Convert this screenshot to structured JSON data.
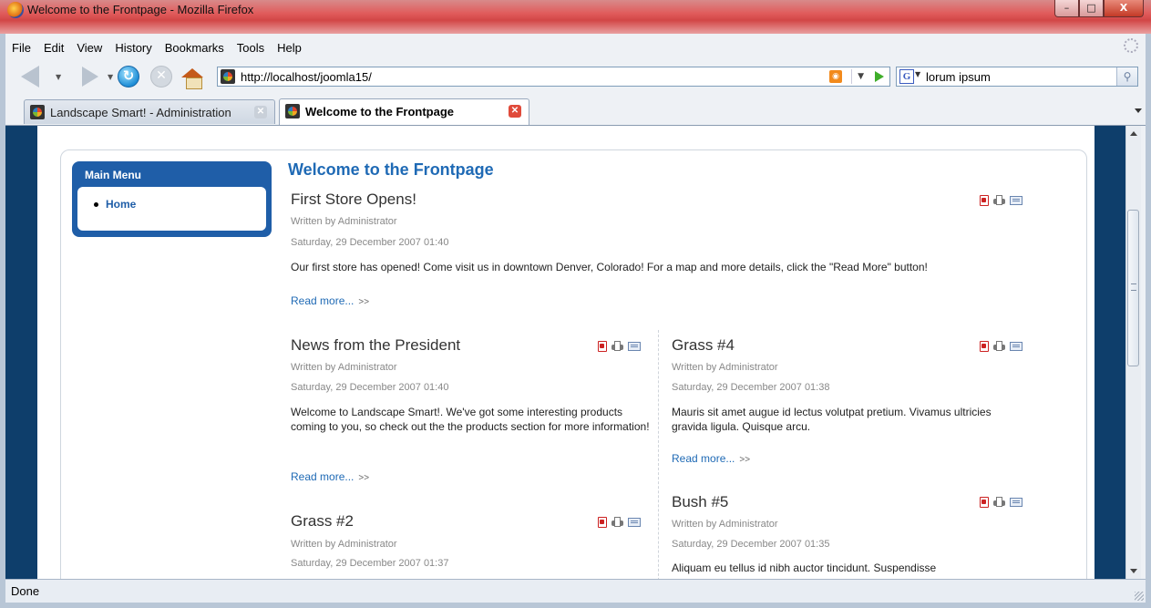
{
  "window": {
    "title": "Welcome to the Frontpage - Mozilla Firefox",
    "buttons": {
      "minimize": "–",
      "maximize": "□",
      "close": "X"
    }
  },
  "menubar": [
    "File",
    "Edit",
    "View",
    "History",
    "Bookmarks",
    "Tools",
    "Help"
  ],
  "navbar": {
    "url": "http://localhost/joomla15/",
    "search_engine": "G",
    "search_query": "lorum ipsum",
    "rss_label": "RSS"
  },
  "tabs": [
    {
      "label": "Landscape Smart! - Administration",
      "active": false
    },
    {
      "label": "Welcome to the Frontpage",
      "active": true
    }
  ],
  "sidebar": {
    "title": "Main Menu",
    "items": [
      {
        "label": "Home"
      }
    ]
  },
  "page": {
    "title": "Welcome to the Frontpage",
    "articles": [
      {
        "title": "First Store Opens!",
        "author": "Written by Administrator",
        "date": "Saturday, 29 December 2007 01:40",
        "body": "Our first store has opened! Come visit us in downtown Denver, Colorado! For a map and more details, click the \"Read More\" button!",
        "read_more": "Read more...",
        "read_more_arrows": ">>"
      },
      {
        "title": "News from the President",
        "author": "Written by Administrator",
        "date": "Saturday, 29 December 2007 01:40",
        "body": "Welcome to Landscape Smart!. We've got some interesting products coming to you, so check out the the products section for more information!",
        "read_more": "Read more...",
        "read_more_arrows": ">>"
      },
      {
        "title": "Grass #4",
        "author": "Written by Administrator",
        "date": "Saturday, 29 December 2007 01:38",
        "body": "Mauris sit amet augue id lectus volutpat pretium. Vivamus ultricies gravida ligula. Quisque arcu.",
        "read_more": "Read more...",
        "read_more_arrows": ">>"
      },
      {
        "title": "Bush #5",
        "author": "Written by Administrator",
        "date": "Saturday, 29 December 2007 01:35",
        "body": "Aliquam eu tellus id nibh auctor tincidunt. Suspendisse"
      },
      {
        "title": "Grass #2",
        "author": "Written by Administrator",
        "date": "Saturday, 29 December 2007 01:37"
      }
    ]
  },
  "status": {
    "text": "Done"
  },
  "colors": {
    "accent": "#1f6ab5",
    "menu_bg": "#1f5ea8",
    "page_bg": "#0e3e6b",
    "titlebar": "#d24646"
  }
}
